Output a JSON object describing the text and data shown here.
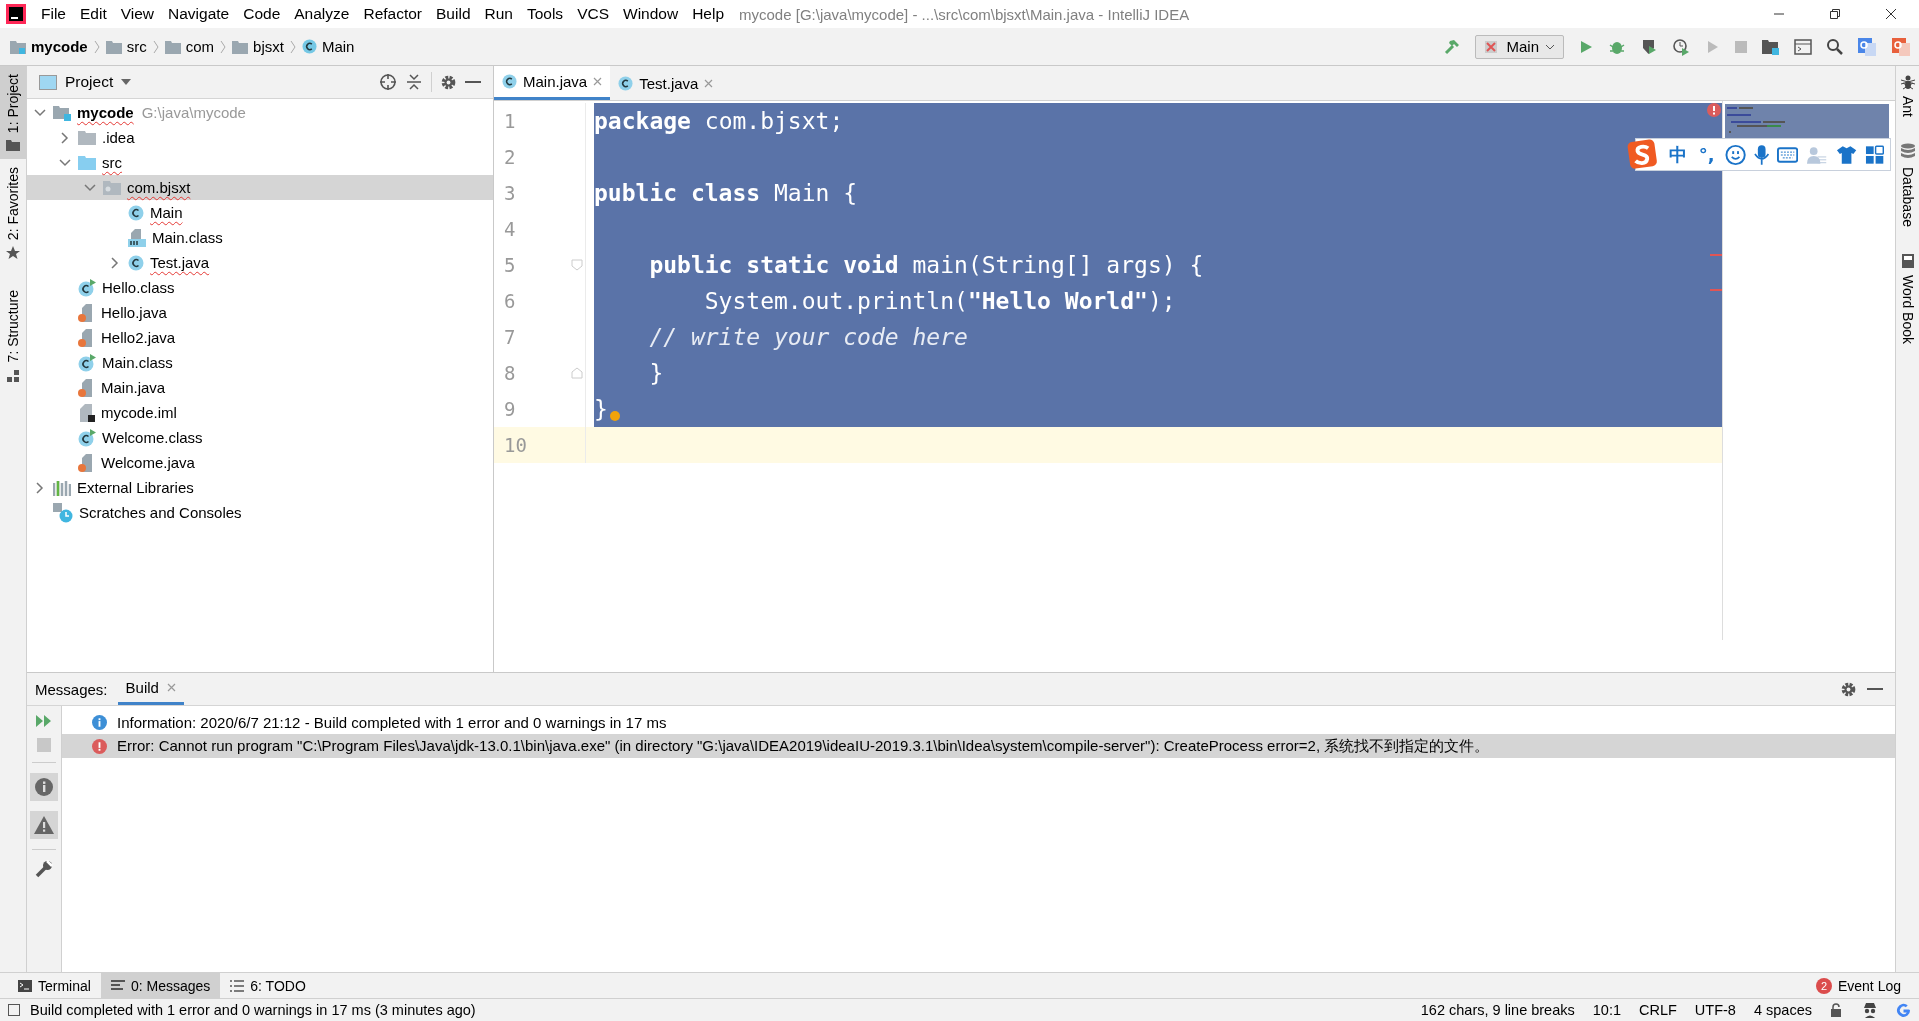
{
  "window": {
    "title": "mycode [G:\\java\\mycode] - ...\\src\\com\\bjsxt\\Main.java - IntelliJ IDEA"
  },
  "menu": [
    "File",
    "Edit",
    "View",
    "Navigate",
    "Code",
    "Analyze",
    "Refactor",
    "Build",
    "Run",
    "Tools",
    "VCS",
    "Window",
    "Help"
  ],
  "breadcrumbs": [
    {
      "kind": "module",
      "label": "mycode"
    },
    {
      "kind": "folder",
      "label": "src"
    },
    {
      "kind": "folder",
      "label": "com"
    },
    {
      "kind": "folder",
      "label": "bjsxt"
    },
    {
      "kind": "class",
      "label": "Main"
    }
  ],
  "run_config": {
    "label": "Main"
  },
  "left_stripe": {
    "top": [
      {
        "label": "1: Project",
        "kind": "folder",
        "selected": true
      }
    ],
    "bottom": [
      {
        "label": "2: Favorites",
        "kind": "star",
        "selected": false
      },
      {
        "label": "7: Structure",
        "kind": "structure",
        "selected": false
      }
    ]
  },
  "right_stripe": {
    "top": [
      {
        "label": "Ant",
        "kind": "ant"
      },
      {
        "label": "Database",
        "kind": "database"
      }
    ],
    "bottom": [
      {
        "label": "Word Book",
        "kind": "book"
      }
    ]
  },
  "project_panel": {
    "title": "Project",
    "tree": [
      {
        "kind": "module",
        "label": "mycode",
        "hint": "G:\\java\\mycode",
        "error": true,
        "expanded": true,
        "selected": false,
        "children": [
          {
            "kind": "folder",
            "label": ".idea",
            "error": false,
            "expanded": false,
            "selected": false
          },
          {
            "kind": "source",
            "label": "src",
            "error": true,
            "expanded": true,
            "selected": false,
            "children": [
              {
                "kind": "package",
                "label": "com.bjsxt",
                "error": true,
                "expanded": true,
                "selected": true,
                "children": [
                  {
                    "kind": "class",
                    "label": "Main",
                    "error": true,
                    "selected": false
                  },
                  {
                    "kind": "classfile",
                    "label": "Main.class",
                    "error": false,
                    "selected": false
                  },
                  {
                    "kind": "class",
                    "label": "Test.java",
                    "error": true,
                    "expanded": false,
                    "selected": false
                  }
                ]
              }
            ]
          },
          {
            "kind": "runclass",
            "label": "Hello.class",
            "error": false,
            "selected": false
          },
          {
            "kind": "java",
            "label": "Hello.java",
            "error": false,
            "selected": false
          },
          {
            "kind": "java",
            "label": "Hello2.java",
            "error": false,
            "selected": false
          },
          {
            "kind": "runclass",
            "label": "Main.class",
            "error": false,
            "selected": false
          },
          {
            "kind": "java",
            "label": "Main.java",
            "error": false,
            "selected": false
          },
          {
            "kind": "iml",
            "label": "mycode.iml",
            "error": false,
            "selected": false
          },
          {
            "kind": "runclass",
            "label": "Welcome.class",
            "error": false,
            "selected": false
          },
          {
            "kind": "java",
            "label": "Welcome.java",
            "error": false,
            "selected": false
          }
        ]
      },
      {
        "kind": "libraries",
        "label": "External Libraries",
        "error": false,
        "expanded": false,
        "selected": false
      },
      {
        "kind": "scratches",
        "label": "Scratches and Consoles",
        "error": false,
        "selected": false
      }
    ]
  },
  "editor": {
    "tabs": [
      {
        "label": "Main.java",
        "selected": true
      },
      {
        "label": "Test.java",
        "selected": false
      }
    ],
    "lines": [
      {
        "number": "1",
        "kind": "plain",
        "selected": true,
        "current": false,
        "intention": false,
        "tokens": [
          {
            "kind": "keyword",
            "text": "package"
          },
          {
            "kind": "plain",
            "text": " com.bjsxt;"
          }
        ]
      },
      {
        "number": "2",
        "kind": "plain",
        "selected": true,
        "current": false,
        "intention": false
      },
      {
        "number": "3",
        "kind": "plain",
        "selected": true,
        "current": false,
        "intention": false,
        "tokens": [
          {
            "kind": "keyword",
            "text": "public class"
          },
          {
            "kind": "plain",
            "text": " Main {"
          }
        ]
      },
      {
        "number": "4",
        "kind": "plain",
        "selected": true,
        "current": false,
        "intention": false
      },
      {
        "number": "5",
        "kind": "fold-start",
        "selected": true,
        "current": false,
        "intention": false,
        "tokens": [
          {
            "kind": "keyword",
            "text": "    public static void"
          },
          {
            "kind": "plain",
            "text": " main(String[] args) {"
          }
        ]
      },
      {
        "number": "6",
        "kind": "plain",
        "selected": true,
        "current": false,
        "intention": false,
        "tokens": [
          {
            "kind": "plain",
            "text": "        System.out.println("
          },
          {
            "kind": "string",
            "text": "\"Hello World\""
          },
          {
            "kind": "plain",
            "text": ");"
          }
        ]
      },
      {
        "number": "7",
        "kind": "plain",
        "selected": true,
        "current": false,
        "intention": false,
        "tokens": [
          {
            "kind": "comment",
            "text": "    // write your code here"
          }
        ]
      },
      {
        "number": "8",
        "kind": "fold-end",
        "selected": true,
        "current": false,
        "intention": false,
        "tokens": [
          {
            "kind": "plain",
            "text": "    }"
          }
        ]
      },
      {
        "number": "9",
        "kind": "plain",
        "selected": true,
        "current": false,
        "intention": true,
        "tokens": [
          {
            "kind": "plain",
            "text": "}"
          }
        ]
      },
      {
        "number": "10",
        "kind": "plain",
        "selected": false,
        "current": true,
        "intention": false
      }
    ]
  },
  "ime_toolbar": {
    "items": [
      "中",
      "°,"
    ]
  },
  "messages_panel": {
    "label": "Messages:",
    "tabs": [
      {
        "label": "Build",
        "selected": true
      }
    ],
    "rows": [
      {
        "kind": "info",
        "selected": false,
        "text": "Information: 2020/6/7 21:12 - Build completed with 1 error and 0 warnings in 17 ms"
      },
      {
        "kind": "error",
        "selected": true,
        "text": "Error: Cannot run program \"C:\\Program Files\\Java\\jdk-13.0.1\\bin\\java.exe\" (in directory \"G:\\java\\IDEA2019\\ideaIU-2019.3.1\\bin\\Idea\\system\\compile-server\"): CreateProcess error=2, 系统找不到指定的文件。"
      }
    ]
  },
  "tool_tabs": [
    {
      "kind": "terminal",
      "label": "Terminal",
      "selected": false
    },
    {
      "kind": "messages",
      "label": "0: Messages",
      "selected": true
    },
    {
      "kind": "todo",
      "label": "6: TODO",
      "selected": false
    }
  ],
  "event_log": {
    "label": "Event Log",
    "count": "2"
  },
  "status_bar": {
    "message": "Build completed with 1 error and 0 warnings in 17 ms (3 minutes ago)",
    "items": [
      "162 chars, 9 line breaks",
      "10:1",
      "CRLF",
      "UTF-8",
      "4 spaces"
    ]
  }
}
